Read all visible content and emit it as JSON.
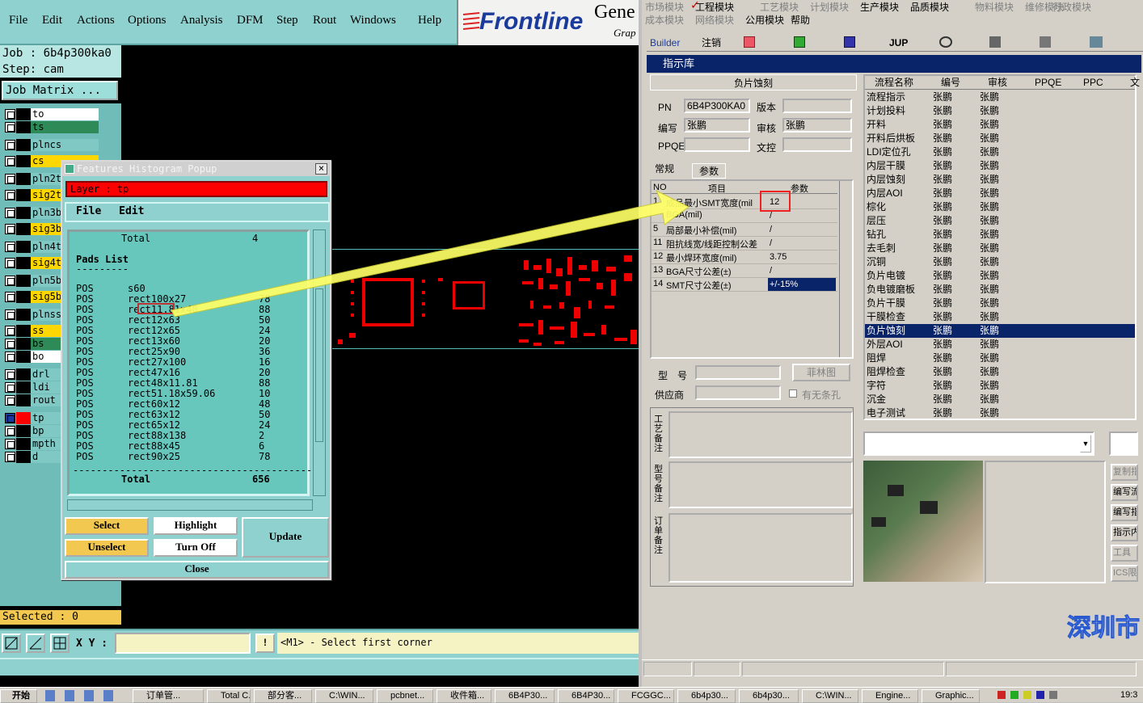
{
  "left_app": {
    "menu": [
      "File",
      "Edit",
      "Actions",
      "Options",
      "Analysis",
      "DFM",
      "Step",
      "Rout",
      "Windows",
      "Help"
    ],
    "logo": "Frontline",
    "logo_right": "Gene",
    "logo_sub": "Grap",
    "job_label": "Job : 6b4p300ka0",
    "step_label": "Step: cam",
    "job_matrix": "Job Matrix ...",
    "layers": [
      {
        "name": "to",
        "color": "#ffffff"
      },
      {
        "name": "ts",
        "color": "#2e8b57"
      },
      {
        "name": "plncs",
        "color": "#7fc8c4"
      },
      {
        "name": "cs",
        "color": "#ffd700"
      },
      {
        "name": "pln2t",
        "color": "#7fc8c4"
      },
      {
        "name": "sig2t",
        "color": "#ffd700"
      },
      {
        "name": "pln3b",
        "color": "#7fc8c4"
      },
      {
        "name": "sig3b",
        "color": "#ffd700"
      },
      {
        "name": "pln4t",
        "color": "#7fc8c4"
      },
      {
        "name": "sig4t",
        "color": "#ffd700"
      },
      {
        "name": "pln5b",
        "color": "#7fc8c4"
      },
      {
        "name": "sig5b",
        "color": "#ffd700"
      },
      {
        "name": "plnss",
        "color": "#7fc8c4"
      },
      {
        "name": "ss",
        "color": "#ffd700"
      },
      {
        "name": "bs",
        "color": "#2e8b57"
      },
      {
        "name": "bo",
        "color": "#ffffff"
      },
      {
        "name": "drl",
        "color": "#7fc8c4"
      },
      {
        "name": "ldi",
        "color": "#7fc8c4"
      },
      {
        "name": "rout",
        "color": "#7fc8c4"
      },
      {
        "name": "tp",
        "color": "#7fc8c4"
      },
      {
        "name": "bp",
        "color": "#7fc8c4"
      },
      {
        "name": "mpth",
        "color": "#7fc8c4"
      },
      {
        "name": "d",
        "color": "#7fc8c4"
      }
    ],
    "selected": "Selected : 0",
    "xy_label": "X Y :",
    "xy_value": "",
    "hint": "<M1> - Select first corner"
  },
  "popup": {
    "title": "Features Histogram Popup",
    "layer": "Layer :  tp",
    "menu": [
      "File",
      "Edit"
    ],
    "total_top_label": "Total",
    "total_top_value": "4",
    "pads_list": "Pads List",
    "pads_sep": "---------",
    "rows": [
      {
        "t": "POS",
        "n": "s60",
        "c": ""
      },
      {
        "t": "POS",
        "n": "rect100x27",
        "c": "78"
      },
      {
        "t": "POS",
        "n": "rect11.81x40",
        "c": "88"
      },
      {
        "t": "POS",
        "n": "rect12x63",
        "c": "50"
      },
      {
        "t": "POS",
        "n": "rect12x65",
        "c": "24"
      },
      {
        "t": "POS",
        "n": "rect13x60",
        "c": "20"
      },
      {
        "t": "POS",
        "n": "rect25x90",
        "c": "36"
      },
      {
        "t": "POS",
        "n": "rect27x100",
        "c": "16"
      },
      {
        "t": "POS",
        "n": "rect47x16",
        "c": "20"
      },
      {
        "t": "POS",
        "n": "rect48x11.81",
        "c": "88"
      },
      {
        "t": "POS",
        "n": "rect51.18x59.06",
        "c": "10"
      },
      {
        "t": "POS",
        "n": "rect60x12",
        "c": "48"
      },
      {
        "t": "POS",
        "n": "rect63x12",
        "c": "50"
      },
      {
        "t": "POS",
        "n": "rect65x12",
        "c": "24"
      },
      {
        "t": "POS",
        "n": "rect88x138",
        "c": "2"
      },
      {
        "t": "POS",
        "n": "rect88x45",
        "c": "6"
      },
      {
        "t": "POS",
        "n": "rect90x25",
        "c": "78"
      }
    ],
    "bottom_sep": "-----------------------------------------",
    "total_label": "Total",
    "total_value": "656",
    "buttons": {
      "select": "Select",
      "highlight": "Highlight",
      "update": "Update",
      "unselect": "Unselect",
      "turn_off": "Turn Off",
      "close": "Close"
    }
  },
  "right_app": {
    "menu_row1": [
      "市场模块",
      "工程模块",
      "工艺模块",
      "计划模块",
      "生产模块",
      "品质模块",
      "物料模块",
      "维修模块",
      "行政模块"
    ],
    "menu_row2": [
      "成本模块",
      "网络模块",
      "公用模块",
      "帮助"
    ],
    "toolbar": [
      "Builder",
      "注销",
      "JUP"
    ],
    "panel_title": "指示库",
    "section": "负片蚀刻",
    "fields": {
      "pn_label": "PN",
      "pn": "6B4P300KA0",
      "ver_label": "版本",
      "ver": "",
      "writer_label": "编写",
      "writer": "张鹏",
      "review_label": "审核",
      "reviewer": "张鹏",
      "ppqe_label": "PPQE",
      "ppqe": "",
      "wk_label": "文控",
      "wk": ""
    },
    "tabs": [
      "常规",
      "参数"
    ],
    "param_headers": [
      "NO",
      "项目",
      "参数"
    ],
    "params": [
      {
        "no": "1",
        "item": "成品最小SMT宽度(mil",
        "val": "12"
      },
      {
        "no": "",
        "item": "BGA(mil)",
        "val": "/"
      },
      {
        "no": "5",
        "item": "局部最小补偿(mil)",
        "val": "/"
      },
      {
        "no": "11",
        "item": "阻抗线宽/线距控制公差",
        "val": "/"
      },
      {
        "no": "12",
        "item": "最小焊环宽度(mil)",
        "val": "3.75"
      },
      {
        "no": "13",
        "item": "BGA尺寸公差(±)",
        "val": "/"
      },
      {
        "no": "14",
        "item": "SMT尺寸公差(±)",
        "val": "+/-15%"
      }
    ],
    "model_label": "型　号",
    "supplier_label": "供应商",
    "film_btn": "菲林图",
    "no_hole": "有无条孔",
    "notes": [
      "工艺备注",
      "型号备注",
      "订单备注"
    ],
    "flow_headers": [
      "流程名称",
      "编号",
      "审核",
      "PPQE",
      "PPC",
      "文"
    ],
    "flow_rows": [
      "流程指示",
      "计划投料",
      "开料",
      "开料后烘板",
      "LDI定位孔",
      "内层干膜",
      "内层蚀刻",
      "内层AOI",
      "棕化",
      "层压",
      "钻孔",
      "去毛刺",
      "沉铜",
      "负片电镀",
      "负电镀磨板",
      "负片干膜",
      "干膜检查",
      "负片蚀刻",
      "外层AOI",
      "阻焊",
      "阻焊检查",
      "字符",
      "沉金",
      "电子测试"
    ],
    "flow_person": "张鹏",
    "side_buttons": [
      "复制指",
      "编写流",
      "编写指",
      "指示内",
      "工具",
      "ICS限"
    ],
    "brand": "深圳市"
  },
  "taskbar": {
    "start": "开始",
    "tasks": [
      "订单管...",
      "Total C...",
      "部分客...",
      "C:\\WIN...",
      "pcbnet...",
      "收件箱...",
      "6B4P30...",
      "6B4P30...",
      "FCGGC...",
      "6b4p30...",
      "6b4p30...",
      "C:\\WIN...",
      "Engine...",
      "Graphic..."
    ],
    "clock": "19:3"
  }
}
